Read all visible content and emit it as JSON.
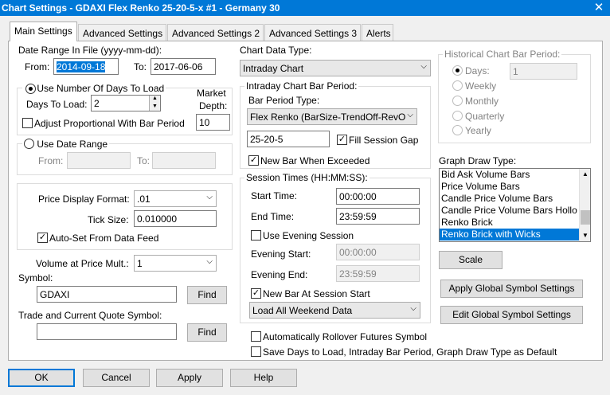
{
  "window": {
    "title": "Chart Settings - GDAXI  Flex Renko 25-20-5-x  #1 - Germany 30"
  },
  "tabs": [
    "Main Settings",
    "Advanced Settings",
    "Advanced Settings 2",
    "Advanced Settings 3",
    "Alerts"
  ],
  "date_range": {
    "label": "Date Range In File (yyyy-mm-dd):",
    "from_label": "From:",
    "from_value": "2014-09-18",
    "to_label": "To:",
    "to_value": "2017-06-06"
  },
  "days_group": {
    "radio_label": "Use Number Of Days To Load",
    "days_label": "Days To Load:",
    "days_value": "2",
    "market_depth_label_1": "Market",
    "market_depth_label_2": "Depth:",
    "market_depth_value": "10",
    "adjust_label": "Adjust Proportional With Bar Period"
  },
  "date_group": {
    "radio_label": "Use Date Range",
    "from_label": "From:",
    "to_label": "To:"
  },
  "price": {
    "format_label": "Price Display Format:",
    "format_value": ".01",
    "tick_label": "Tick Size:",
    "tick_value": "0.010000",
    "autoset_label": "Auto-Set From Data Feed"
  },
  "volume": {
    "label": "Volume at Price Mult.:",
    "value": "1"
  },
  "symbol": {
    "label": "Symbol:",
    "value": "GDAXI",
    "find": "Find"
  },
  "trade_symbol": {
    "label": "Trade and Current Quote Symbol:",
    "value": "",
    "find": "Find"
  },
  "chart_data_type": {
    "label": "Chart Data Type:",
    "value": "Intraday Chart"
  },
  "intraday": {
    "group_label": "Intraday Chart Bar Period:",
    "type_label": "Bar Period Type:",
    "type_value": "Flex Renko (BarSize-TrendOff-RevO",
    "period_value": "25-20-5",
    "fill_gap_label": "Fill Session Gap",
    "new_bar_label": "New Bar When Exceeded"
  },
  "session": {
    "group_label": "Session Times (HH:MM:SS):",
    "start_label": "Start Time:",
    "start_value": "00:00:00",
    "end_label": "End Time:",
    "end_value": "23:59:59",
    "evening_label": "Use Evening Session",
    "evening_start_label": "Evening Start:",
    "evening_start_value": "00:00:00",
    "evening_end_label": "Evening End:",
    "evening_end_value": "23:59:59",
    "new_bar_session_label": "New Bar At Session Start",
    "weekend_value": "Load All Weekend Data"
  },
  "rollover_label": "Automatically Rollover Futures Symbol",
  "save_default_label": "Save Days to Load, Intraday Bar Period, Graph Draw Type as Default",
  "historical": {
    "label": "Historical Chart Bar Period:",
    "options": [
      "Days:",
      "Weekly",
      "Monthly",
      "Quarterly",
      "Yearly"
    ],
    "days_value": "1"
  },
  "graph_draw": {
    "label": "Graph Draw Type:",
    "items": [
      "Bid Ask Volume Bars",
      "Price Volume Bars",
      "Candle Price Volume Bars",
      "Candle Price Volume Bars Hollo",
      "Renko Brick",
      "Renko Brick with Wicks"
    ]
  },
  "scale_button": "Scale",
  "apply_global_button": "Apply Global Symbol Settings",
  "edit_global_button": "Edit Global Symbol Settings",
  "bottom": {
    "ok": "OK",
    "cancel": "Cancel",
    "apply": "Apply",
    "help": "Help"
  },
  "colors": {
    "accent": "#0078d7",
    "title_bg": "#0078d7"
  }
}
